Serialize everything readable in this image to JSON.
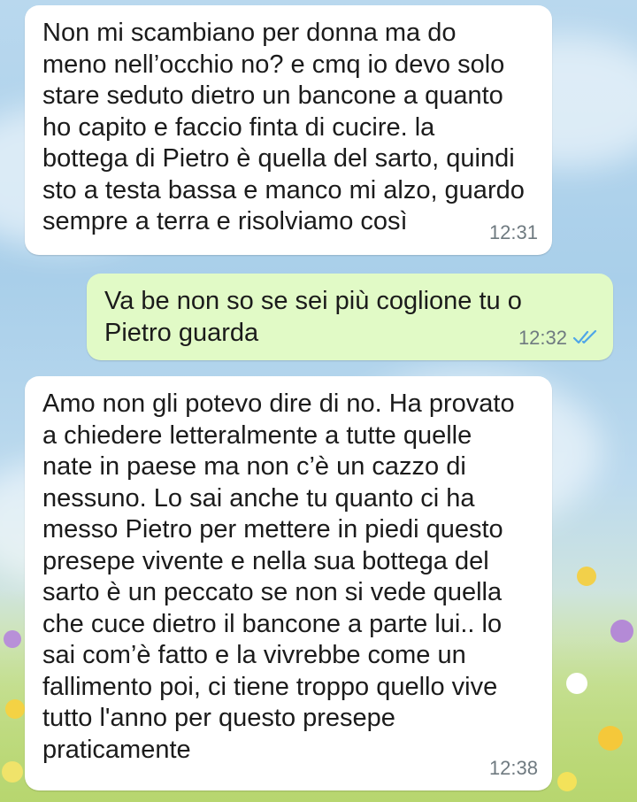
{
  "chat": {
    "messages": [
      {
        "direction": "incoming",
        "text": "Non mi scambiano per donna ma do\nmeno nell’occhio no? e cmq io devo solo\nstare seduto dietro un bancone a quanto\nho capito e faccio finta di cucire. la\nbottega di Pietro è quella del sarto, quindi\nsto a testa bassa e manco mi alzo, guardo\nsempre a terra e risolviamo così",
        "time": "12:31"
      },
      {
        "direction": "outgoing",
        "text": "Va be non so se sei più coglione tu o\nPietro guarda",
        "time": "12:32",
        "status": "read-double-check-icon"
      },
      {
        "direction": "incoming",
        "text": "Amo non gli potevo dire di no. Ha provato\na chiedere letteralmente a tutte quelle\nnate in paese ma non c’è un cazzo di\nnessuno. Lo sai anche tu quanto ci ha\nmesso Pietro per mettere in piedi questo\npresepe vivente e nella sua bottega del\nsarto è un peccato se non si vede quella\nche cuce dietro il bancone a parte lui.. lo\nsai com’è fatto e la vivrebbe come un\nfallimento poi, ci tiene troppo quello vive\ntutto l'anno per questo presepe\npraticamente",
        "time": "12:38"
      }
    ]
  },
  "colors": {
    "incoming_bubble": "#ffffff",
    "outgoing_bubble": "#e1fac6",
    "timestamp": "#6f7a80",
    "read_ticks": "#4fa6e8",
    "wallpaper_sky": "#a9cfea",
    "wallpaper_meadow": "#b7d66f"
  }
}
